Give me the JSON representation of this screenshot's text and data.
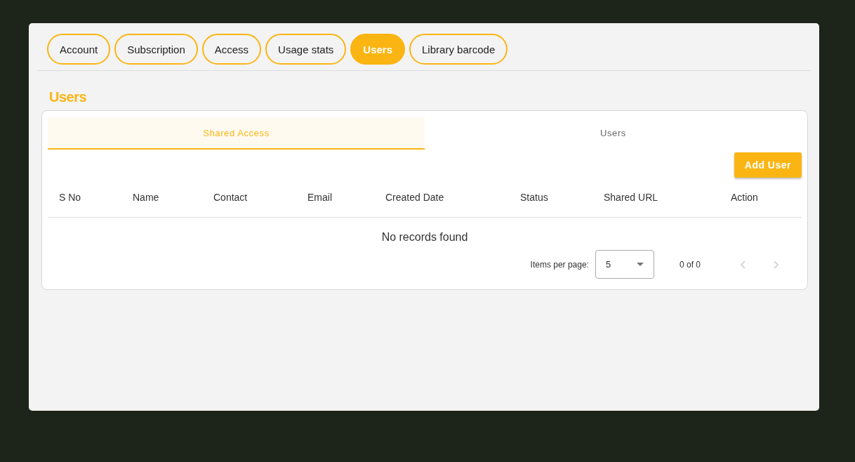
{
  "tabs": [
    {
      "label": "Account",
      "selected": false
    },
    {
      "label": "Subscription",
      "selected": false
    },
    {
      "label": "Access",
      "selected": false
    },
    {
      "label": "Usage stats",
      "selected": false
    },
    {
      "label": "Users",
      "selected": true
    },
    {
      "label": "Library barcode",
      "selected": false
    }
  ],
  "heading": "Users",
  "subtabs": [
    {
      "label": "Shared Access",
      "selected": true
    },
    {
      "label": "Users",
      "selected": false
    }
  ],
  "add_button": "Add User",
  "table": {
    "columns": [
      "S No",
      "Name",
      "Contact",
      "Email",
      "Created Date",
      "Status",
      "Shared URL",
      "Action"
    ],
    "empty_message": "No records found"
  },
  "paginator": {
    "items_label": "Items per page:",
    "page_size": "5",
    "range": "0 of 0",
    "previous_disabled": true,
    "next_disabled": true
  }
}
